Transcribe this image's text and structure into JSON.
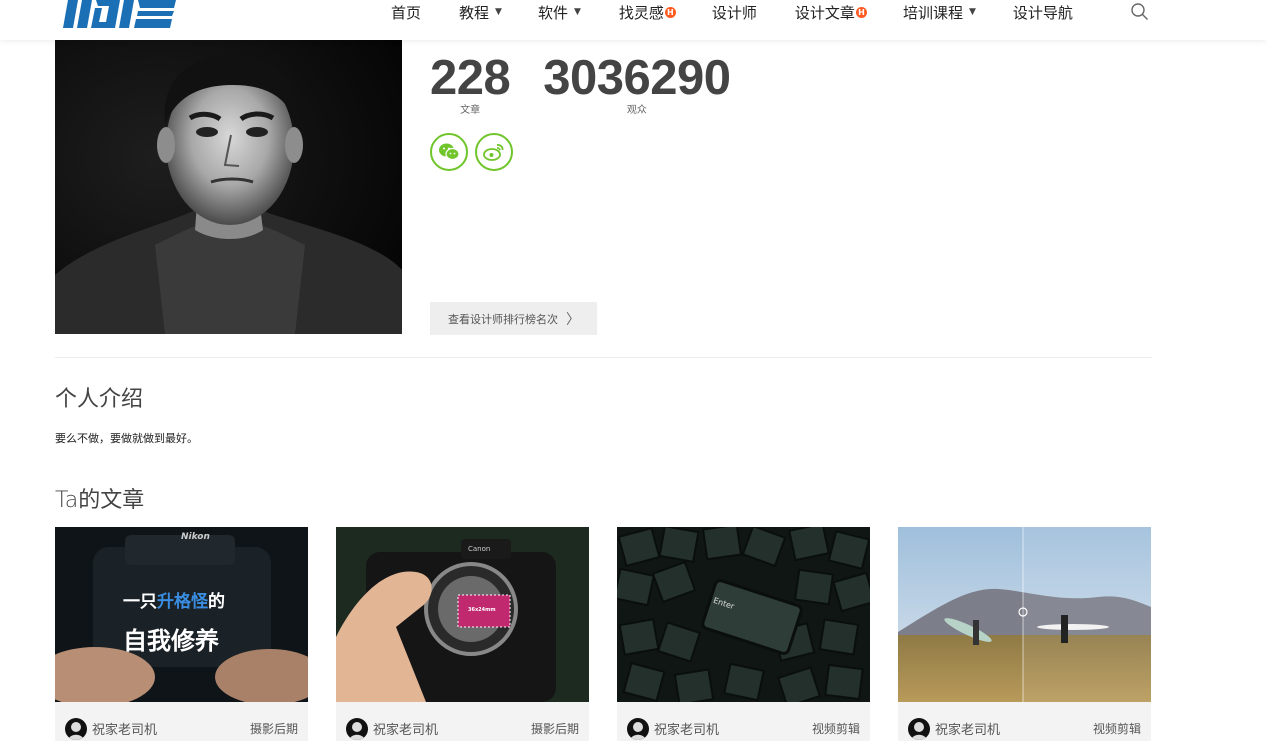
{
  "header": {
    "nav": [
      {
        "label": "首页",
        "dropdown": false,
        "hot": false
      },
      {
        "label": "教程",
        "dropdown": true,
        "hot": false
      },
      {
        "label": "软件",
        "dropdown": true,
        "hot": false
      },
      {
        "label": "找灵感",
        "dropdown": false,
        "hot": true
      },
      {
        "label": "设计师",
        "dropdown": false,
        "hot": false
      },
      {
        "label": "设计文章",
        "dropdown": false,
        "hot": true
      },
      {
        "label": "培训课程",
        "dropdown": true,
        "hot": false
      },
      {
        "label": "设计导航",
        "dropdown": false,
        "hot": false
      }
    ],
    "hot_badge": "H",
    "search_icon": "search-icon",
    "brand_color": "#1b6fb5"
  },
  "profile": {
    "articles_count": "228",
    "articles_label": "文章",
    "audience_count": "3036290",
    "audience_label": "观众",
    "socials": [
      {
        "icon": "wechat-icon"
      },
      {
        "icon": "weibo-icon"
      }
    ],
    "social_color": "#6fc52a",
    "rank_button": "查看设计师排行榜名次",
    "rank_chevron": "〉"
  },
  "intro": {
    "title": "个人介绍",
    "text": "要么不做，要做就做到最好。"
  },
  "articles": {
    "title": "Ta的文章",
    "items": [
      {
        "author": "祝家老司机",
        "category": "摄影后期",
        "overlay_line1_pre": "一只",
        "overlay_line1_hl": "升格怪",
        "overlay_line1_post": "的",
        "overlay_line2": "自我修养",
        "camera_brand": "Nikon"
      },
      {
        "author": "祝家老司机",
        "category": "摄影后期",
        "camera_brand": "Canon",
        "sensor_label": "36x24mm"
      },
      {
        "author": "祝家老司机",
        "category": "视频剪辑",
        "key_label": "Enter"
      },
      {
        "author": "祝家老司机",
        "category": "视频剪辑"
      }
    ]
  }
}
